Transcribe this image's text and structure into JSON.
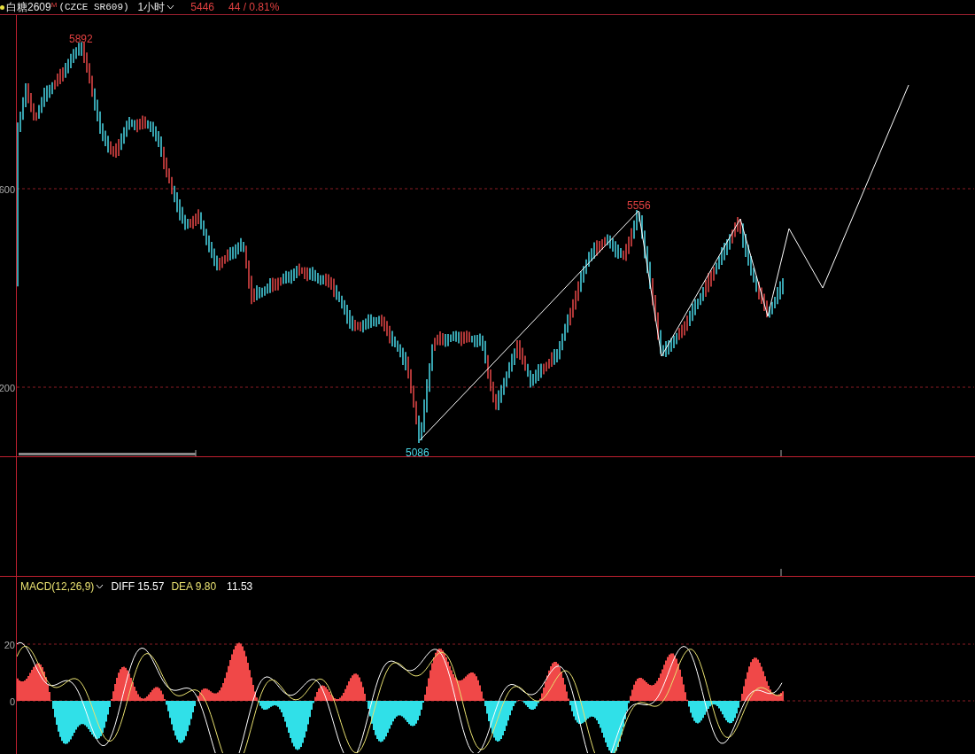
{
  "header": {
    "symbol": "白糖2609",
    "badge": "M",
    "code": "(CZCE SR609)",
    "period": "1小时",
    "price": "5446",
    "change": "44 / 0.81%"
  },
  "price_pane": {
    "axis_labels": [
      "600",
      "200"
    ],
    "high_label": "5892",
    "peak_label": "5556",
    "low_label": "5086"
  },
  "macd_pane": {
    "title": "MACD(12,26,9)",
    "diff": "DIFF 15.57",
    "dea": "DEA 9.80",
    "value": "11.53",
    "axis_labels": [
      "20",
      "0"
    ]
  }
}
